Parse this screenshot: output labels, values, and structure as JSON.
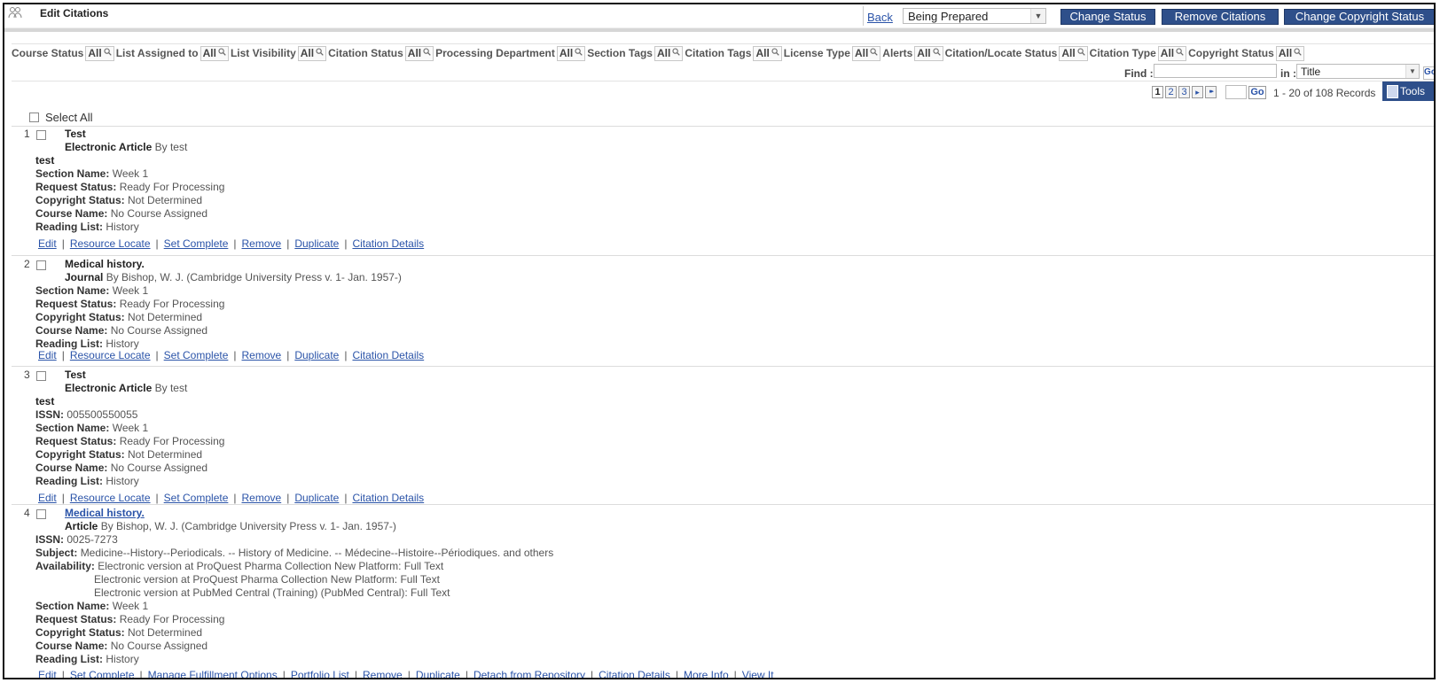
{
  "header": {
    "title": "Edit Citations",
    "back_label": "Back",
    "status_value": "Being Prepared",
    "buttons": {
      "change_status": "Change Status",
      "remove_citations": "Remove Citations",
      "change_copyright": "Change Copyright Status"
    }
  },
  "filters": [
    {
      "label": "Course Status",
      "value": "All"
    },
    {
      "label": "List Assigned to",
      "value": "All"
    },
    {
      "label": "List Visibility",
      "value": "All"
    },
    {
      "label": "Citation Status",
      "value": "All"
    },
    {
      "label": "Processing Department",
      "value": "All"
    },
    {
      "label": "Section Tags",
      "value": "All"
    },
    {
      "label": "Citation Tags",
      "value": "All"
    },
    {
      "label": "License Type",
      "value": "All"
    },
    {
      "label": "Alerts",
      "value": "All"
    },
    {
      "label": "Citation/Locate Status",
      "value": "All"
    },
    {
      "label": "Citation Type",
      "value": "All"
    },
    {
      "label": "Copyright Status",
      "value": "All"
    }
  ],
  "find": {
    "label": "Find :",
    "in_label": "in :",
    "in_value": "Title",
    "go": "Go"
  },
  "pagination": {
    "pages": [
      "1",
      "2",
      "3"
    ],
    "next": "▸",
    "last": "▸▸",
    "go": "Go",
    "records": "1 - 20 of 108 Records",
    "tools": "Tools"
  },
  "select_all": "Select All",
  "labels": {
    "section": "Section Name:",
    "request": "Request Status:",
    "copyright": "Copyright Status:",
    "course": "Course Name:",
    "reading": "Reading List:",
    "issn": "ISSN:",
    "subject": "Subject:",
    "availability": "Availability:"
  },
  "rows": [
    {
      "num": "1",
      "title": "Test",
      "type": "Electronic Article",
      "by": "By test",
      "subtitle": "test",
      "section": "Week 1",
      "request": "Ready For Processing",
      "copyright": "Not Determined",
      "course": "No Course Assigned",
      "reading": "History",
      "actions": [
        "Edit",
        "Resource Locate",
        "Set Complete",
        "Remove",
        "Duplicate",
        "Citation Details"
      ]
    },
    {
      "num": "2",
      "title": "Medical history.",
      "type": "Journal",
      "by": "By Bishop, W. J. (Cambridge University Press v. 1- Jan. 1957-)",
      "section": "Week 1",
      "request": "Ready For Processing",
      "copyright": "Not Determined",
      "course": "No Course Assigned",
      "reading": "History",
      "actions": [
        "Edit",
        "Resource Locate",
        "Set Complete",
        "Remove",
        "Duplicate",
        "Citation Details"
      ]
    },
    {
      "num": "3",
      "title": "Test",
      "type": "Electronic Article",
      "by": "By test",
      "subtitle": "test",
      "issn": "005500550055",
      "section": "Week 1",
      "request": "Ready For Processing",
      "copyright": "Not Determined",
      "course": "No Course Assigned",
      "reading": "History",
      "actions": [
        "Edit",
        "Resource Locate",
        "Set Complete",
        "Remove",
        "Duplicate",
        "Citation Details"
      ]
    },
    {
      "num": "4",
      "title": "Medical history.",
      "type": "Article",
      "by": "By Bishop, W. J. (Cambridge University Press v. 1- Jan. 1957-)",
      "issn": "0025-7273",
      "subject": "Medicine--History--Periodicals. -- History of Medicine. -- Médecine--Histoire--Périodiques. and others",
      "availability": [
        "Electronic version at ProQuest Pharma Collection New Platform: Full Text",
        "Electronic version at ProQuest Pharma Collection New Platform: Full Text",
        "Electronic version at PubMed Central (Training) (PubMed Central): Full Text"
      ],
      "section": "Week 1",
      "request": "Ready For Processing",
      "copyright": "Not Determined",
      "course": "No Course Assigned",
      "reading": "History",
      "actions": [
        "Edit",
        "Set Complete",
        "Manage Fulfillment Options",
        "Portfolio List",
        "Remove",
        "Duplicate",
        "Detach from Repository",
        "Citation Details",
        "More Info",
        "View It"
      ]
    }
  ]
}
